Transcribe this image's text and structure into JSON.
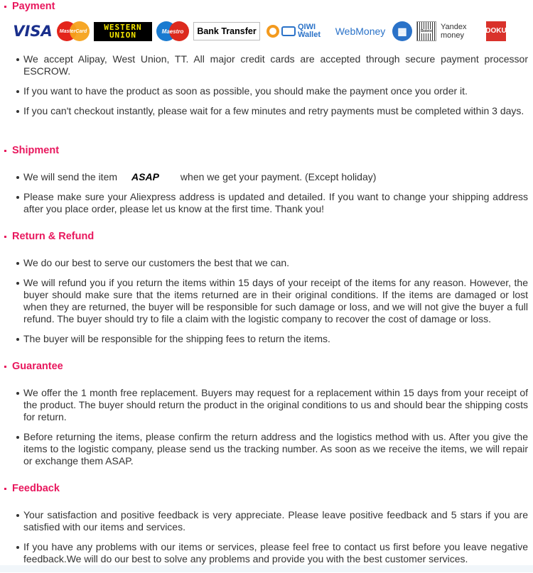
{
  "sections": {
    "payment": {
      "title": "Payment",
      "logos": [
        "VISA",
        "MasterCard",
        "WESTERN UNION",
        "Maestro",
        "Bank Transfer",
        "QIWI Wallet",
        "WebMoney",
        "Boleto",
        "Yandex money",
        "DOKU"
      ],
      "items": [
        "We accept Alipay, West Union, TT. All major credit cards are accepted through secure payment processor ESCROW.",
        "If you want to have the product as soon as possible, you should make the payment once you order it.",
        "If you can't checkout instantly, please wait for a few minutes and retry payments must be completed within 3 days."
      ]
    },
    "shipment": {
      "title": "Shipment",
      "item1_pre": "We will send the item",
      "item1_em": "ASAP",
      "item1_post": "when we get your payment. (Except holiday)",
      "items": [
        "",
        "Please make sure your Aliexpress address is updated and detailed. If you want to change your shipping address after you place order, please let us know at the first time. Thank you!"
      ]
    },
    "refund": {
      "title": "Return & Refund",
      "items": [
        "We do our best to serve our customers the best that we can.",
        "We will refund you if you return the items within 15 days of your receipt of the items for any reason. However, the buyer should make sure that the items returned are in their original conditions.  If the items are damaged or lost when they are returned, the buyer will be responsible for such damage or loss, and we will not give the buyer a full refund. The buyer should try to file a claim with the logistic company to recover the cost of damage or loss.",
        "The buyer will be responsible for the shipping fees to return the items."
      ]
    },
    "guarantee": {
      "title": "Guarantee",
      "items": [
        "We offer the 1 month free replacement.  Buyers may request for a replacement within 15 days from your receipt of the product. The buyer should return the product in the original conditions to us and should bear the shipping costs for return.",
        "Before returning the items, please confirm the return address and the logistics method with us. After you give the items to the logistic company, please send us the tracking number.  As soon as we receive the items, we will repair or exchange them ASAP."
      ]
    },
    "feedback": {
      "title": "Feedback",
      "items": [
        "Your satisfaction and positive feedback is very appreciate.  Please leave positive feedback and 5 stars if you are satisfied with our items and services.",
        "If you have any problems with our items or services, please feel free to contact us first before you leave negative feedback.We will do our best to solve any problems and provide you with the best customer services."
      ]
    }
  },
  "colors": {
    "heading": "#e8175d",
    "text": "#333333"
  }
}
